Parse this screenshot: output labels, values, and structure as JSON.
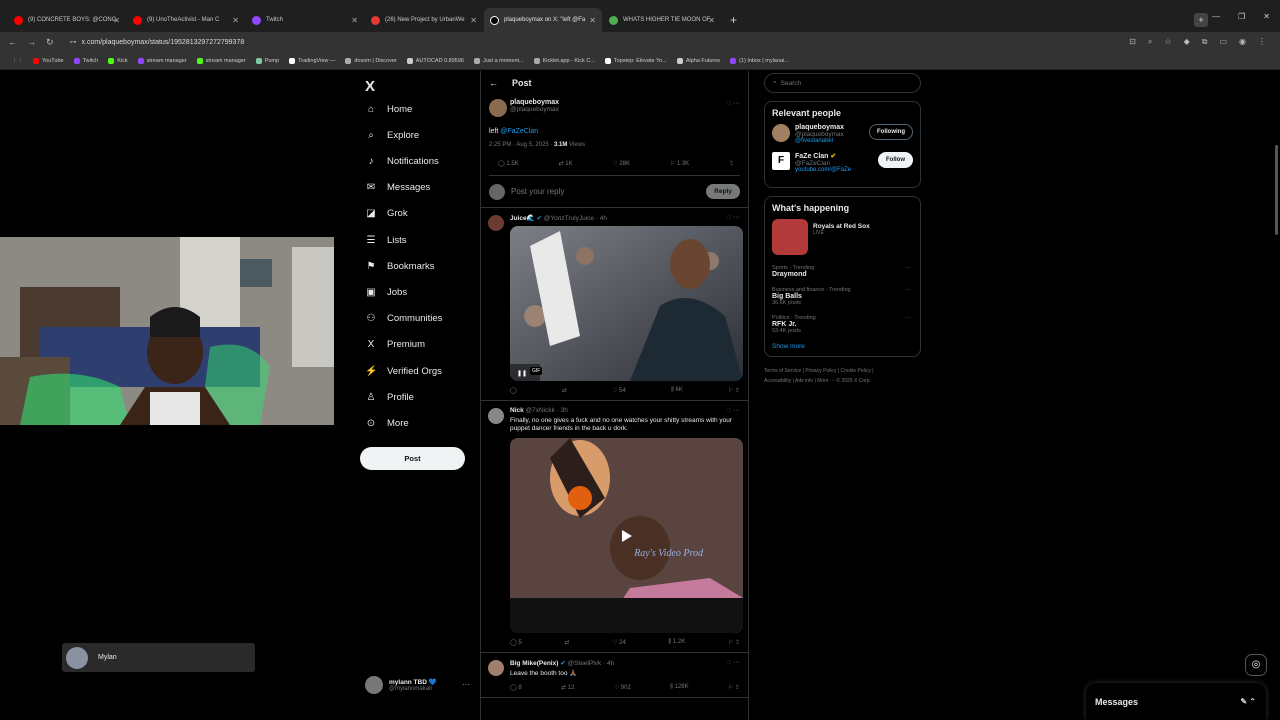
{
  "browser": {
    "tabs": [
      {
        "title": "(9) CONCRETE BOYS: @CONC",
        "color": "#ff0000"
      },
      {
        "title": "(9) UnoTheActivist - Man C",
        "color": "#ff0000"
      },
      {
        "title": "Twitch",
        "color": "#9146ff"
      },
      {
        "title": "(26) New Project by UrbanWe",
        "color": "#e53935"
      },
      {
        "title": "plaqueboymax on X: \"left @Fa",
        "color": "#ffffff"
      },
      {
        "title": "WHATS HIGHER TIE MOON OF",
        "color": "#4caf50"
      }
    ],
    "new_tab": "+",
    "url": "x.com/plaqueboymax/status/1952813297272799378",
    "bookmarks": [
      {
        "label": "YouTube",
        "color": "#ff0000"
      },
      {
        "label": "Twitch",
        "color": "#9146ff"
      },
      {
        "label": "Kick",
        "color": "#53fc18"
      },
      {
        "label": "stream manager",
        "color": "#9146ff"
      },
      {
        "label": "stream manager",
        "color": "#53fc18"
      },
      {
        "label": "Pump",
        "color": "#7ec8a0"
      },
      {
        "label": "TradingView —",
        "color": "#ffffff"
      },
      {
        "label": "Trac",
        "color": "#aaaaaa"
      },
      {
        "label": "dosom | Discover",
        "color": "#ffffff"
      },
      {
        "label": "AUTOCAD 0.89596",
        "color": "#cccccc"
      },
      {
        "label": "Just a moment...",
        "color": "#aaaaaa"
      },
      {
        "label": "Kicklet.app - Kick C...",
        "color": "#aaaaaa"
      },
      {
        "label": "Topstep: Elevate Yo...",
        "color": "#ffffff"
      },
      {
        "label": "Alpha Futures",
        "color": "#cccccc"
      },
      {
        "label": "(1) Inbox | mylanai...",
        "color": "#9146ff"
      }
    ]
  },
  "nav": {
    "logo": "X",
    "items": [
      {
        "label": "Home",
        "icon": "⌂"
      },
      {
        "label": "Explore",
        "icon": "⌕"
      },
      {
        "label": "Notifications",
        "icon": "🔔"
      },
      {
        "label": "Messages",
        "icon": "✉"
      },
      {
        "label": "Grok",
        "icon": "◪"
      },
      {
        "label": "Lists",
        "icon": "☰"
      },
      {
        "label": "Bookmarks",
        "icon": "⚑"
      },
      {
        "label": "Jobs",
        "icon": "▣"
      },
      {
        "label": "Communities",
        "icon": "👥"
      },
      {
        "label": "Premium",
        "icon": "X"
      },
      {
        "label": "Verified Orgs",
        "icon": "⚡"
      },
      {
        "label": "Profile",
        "icon": "👤"
      },
      {
        "label": "More",
        "icon": "⊙"
      }
    ],
    "post_button": "Post",
    "account": {
      "name": "mylann TBD 💙",
      "handle": "@mylanomakall",
      "more": "···"
    }
  },
  "post": {
    "header": "Post",
    "author": "plaqueboymax",
    "handle": "@plaqueboymax",
    "text_prefix": "left ",
    "text_mention": "@FaZeClan",
    "time": "2:25 PM · Aug 5, 2025 · ",
    "views_count": "3.1M",
    "views_label": " Views",
    "actions": {
      "replies": "1.5K",
      "reposts": "1K",
      "likes": "28K",
      "bookmarks": "1.3K"
    }
  },
  "reply_box": {
    "placeholder": "Post your reply",
    "button": "Reply"
  },
  "replies": [
    {
      "name": "Juice🌊",
      "handle": "@YonzTrulyJuice · 4h",
      "text": "",
      "media_label": "GIF",
      "actions": {
        "replies": "",
        "reposts": "",
        "likes": "54",
        "views": "6K"
      }
    },
    {
      "name": "Nick",
      "handle": "@7xNickk · 3h",
      "text": "Finally, no one gives a fuck and no one watches your shitty streams with your puppet dancer friends in the back u dork.",
      "media_label": "Ray's Video Prod",
      "actions": {
        "replies": "5",
        "reposts": "",
        "likes": "24",
        "views": "1.2K"
      }
    },
    {
      "name": "Big Mike(Penix)",
      "handle": "@SteelPlvk · 4h",
      "text": "Leave the booth too 🙏🏾",
      "actions": {
        "replies": "8",
        "reposts": "12",
        "likes": "902",
        "views": "128K"
      }
    }
  ],
  "sidebar": {
    "search_placeholder": "Search",
    "relevant_title": "Relevant people",
    "people": [
      {
        "name": "plaqueboymax",
        "handle": "@plaqueboymax",
        "extra": "@fivestarlabel",
        "button": "Following"
      },
      {
        "name": "FaZe Clan",
        "handle": "@FaZeClan",
        "extra": "youtube.com/@FaZe",
        "button": "Follow"
      }
    ],
    "happening_title": "What's happening",
    "live": {
      "name": "Royals at Red Sox",
      "status": "LIVE"
    },
    "trends": [
      {
        "meta": "Sports · Trending",
        "name": "Draymond",
        "count": ""
      },
      {
        "meta": "Business and finance · Trending",
        "name": "Big Balls",
        "count": "36.6K posts"
      },
      {
        "meta": "Politics · Trending",
        "name": "RFK Jr.",
        "count": "53.4K posts"
      }
    ],
    "show_more": "Show more",
    "footer": [
      "Terms of Service",
      "Privacy Policy",
      "Cookie Policy",
      "Accessibility",
      "Ads info",
      "More ···",
      "© 2025 X Corp."
    ]
  },
  "overlay": {
    "badge_name": "Mylan"
  },
  "messages_drawer": "Messages"
}
